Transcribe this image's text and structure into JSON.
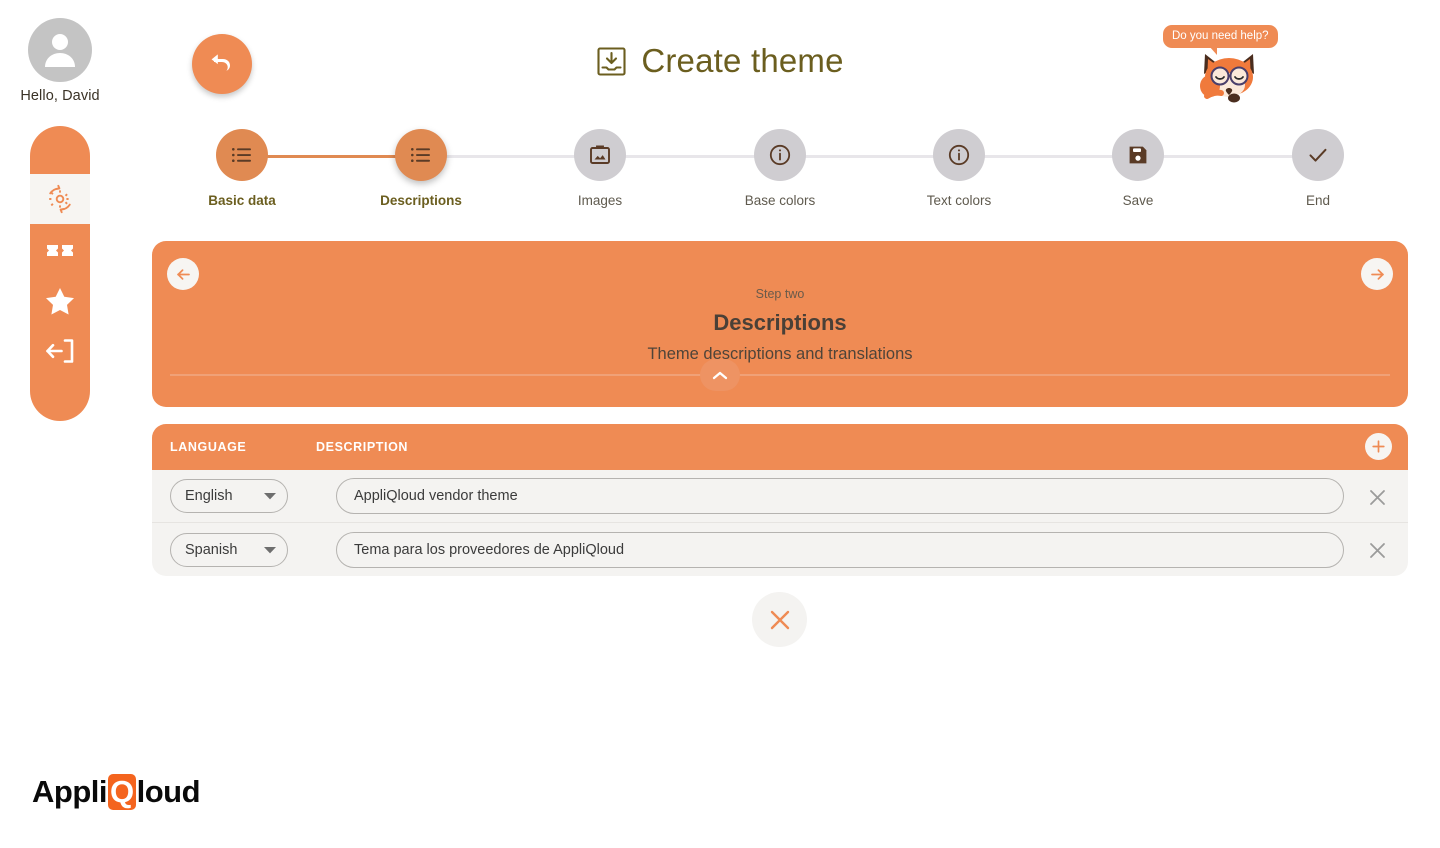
{
  "user": {
    "greeting": "Hello, David",
    "avatar_icon": "person-icon"
  },
  "sidebar": {
    "items": [
      {
        "name": "settings-sync",
        "icon": "gear-refresh-icon",
        "active": true
      },
      {
        "name": "tickets",
        "icon": "ticket-icon",
        "active": false
      },
      {
        "name": "favorites",
        "icon": "star-icon",
        "active": false
      },
      {
        "name": "logout",
        "icon": "logout-icon",
        "active": false
      }
    ]
  },
  "header": {
    "title": "Create theme",
    "title_icon": "import-download-icon",
    "undo_icon": "undo-arrow-icon"
  },
  "help": {
    "bubble_text": "Do you need help?",
    "mascot_icon": "fox-mascot-icon"
  },
  "stepper": {
    "steps": [
      {
        "label": "Basic data",
        "icon": "list-icon",
        "state": "done"
      },
      {
        "label": "Descriptions",
        "icon": "list-icon",
        "state": "current"
      },
      {
        "label": "Images",
        "icon": "image-icon",
        "state": "pending"
      },
      {
        "label": "Base colors",
        "icon": "info-icon",
        "state": "pending"
      },
      {
        "label": "Text colors",
        "icon": "info-icon",
        "state": "pending"
      },
      {
        "label": "Save",
        "icon": "save-disk-icon",
        "state": "pending"
      },
      {
        "label": "End",
        "icon": "check-icon",
        "state": "pending"
      }
    ]
  },
  "banner": {
    "step_number": "Step two",
    "heading": "Descriptions",
    "subtitle": "Theme descriptions and translations",
    "prev_icon": "arrow-left-icon",
    "next_icon": "arrow-right-icon",
    "collapse_icon": "chevron-up-icon"
  },
  "table": {
    "columns": [
      "LANGUAGE",
      "DESCRIPTION"
    ],
    "add_icon": "plus-icon",
    "delete_icon": "close-x-icon",
    "dropdown_icon": "chevron-down-icon",
    "rows": [
      {
        "language": "English",
        "description": "AppliQloud vendor theme"
      },
      {
        "language": "Spanish",
        "description": "Tema para los proveedores de AppliQloud"
      }
    ]
  },
  "footer_action": {
    "close_icon": "close-x-icon"
  },
  "brand": {
    "part1": "Appli",
    "highlight": "Q",
    "part2": "loud"
  },
  "colors": {
    "primary_orange": "#ef8b54",
    "step_active": "#e08a52",
    "step_pending": "#cfcdd1",
    "icon_brown": "#5a3b26",
    "label_olive": "#6b5e1f",
    "panel_grey": "#f4f3f1",
    "logo_orange": "#f4641e"
  }
}
